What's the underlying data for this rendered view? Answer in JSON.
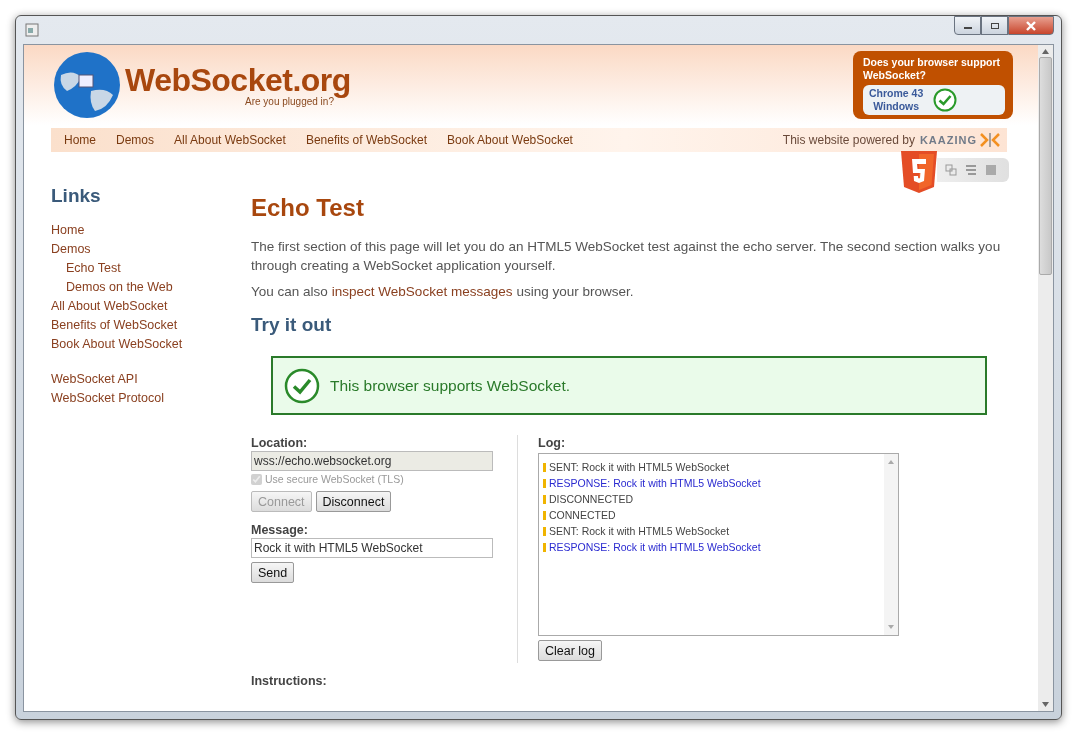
{
  "site": {
    "logo": "WebSocket.org",
    "tagline": "Are you plugged in?"
  },
  "support_box": {
    "question": "Does your browser support WebSocket?",
    "browser": "Chrome 43",
    "os": "Windows",
    "supported": true
  },
  "nav": {
    "items": [
      {
        "label": "Home"
      },
      {
        "label": "Demos"
      },
      {
        "label": "All About WebSocket"
      },
      {
        "label": "Benefits of WebSocket"
      },
      {
        "label": "Book About WebSocket"
      }
    ],
    "powered_by": "This website powered by",
    "brand": "KAAZING"
  },
  "sidebar": {
    "title": "Links",
    "groups": [
      [
        {
          "label": "Home"
        },
        {
          "label": "Demos",
          "children": [
            {
              "label": "Echo Test"
            },
            {
              "label": "Demos on the Web"
            }
          ]
        },
        {
          "label": "All About WebSocket"
        },
        {
          "label": "Benefits of WebSocket"
        },
        {
          "label": "Book About WebSocket"
        }
      ],
      [
        {
          "label": "WebSocket API"
        },
        {
          "label": "WebSocket Protocol"
        }
      ]
    ]
  },
  "main": {
    "title": "Echo Test",
    "intro": "The first section of this page will let you do an HTML5 WebSocket test against the echo server. The second section walks you through creating a WebSocket application yourself.",
    "also_before": "You can also",
    "also_link": "inspect WebSocket messages",
    "also_after": "using your browser.",
    "section": "Try it out",
    "support_message": "This browser supports WebSocket.",
    "supported": true
  },
  "form": {
    "location_label": "Location:",
    "location_value": "wss://echo.websocket.org",
    "tls": {
      "label": "Use secure WebSocket (TLS)",
      "checked": true,
      "disabled": true
    },
    "buttons": [
      {
        "label": "Connect",
        "disabled": true
      },
      {
        "label": "Disconnect",
        "disabled": false
      }
    ],
    "message_label": "Message:",
    "message_value": "Rock it with HTML5 WebSocket",
    "send": "Send",
    "instructions_label": "Instructions:"
  },
  "log": {
    "label": "Log:",
    "entries": [
      {
        "text": "SENT: Rock it with HTML5 WebSocket",
        "kind": "sent"
      },
      {
        "text": "RESPONSE: Rock it with HTML5 WebSocket",
        "kind": "response"
      },
      {
        "text": "DISCONNECTED",
        "kind": "status"
      },
      {
        "text": "CONNECTED",
        "kind": "status"
      },
      {
        "text": "SENT: Rock it with HTML5 WebSocket",
        "kind": "sent"
      },
      {
        "text": "RESPONSE: Rock it with HTML5 WebSocket",
        "kind": "response"
      }
    ],
    "clear": "Clear log"
  }
}
